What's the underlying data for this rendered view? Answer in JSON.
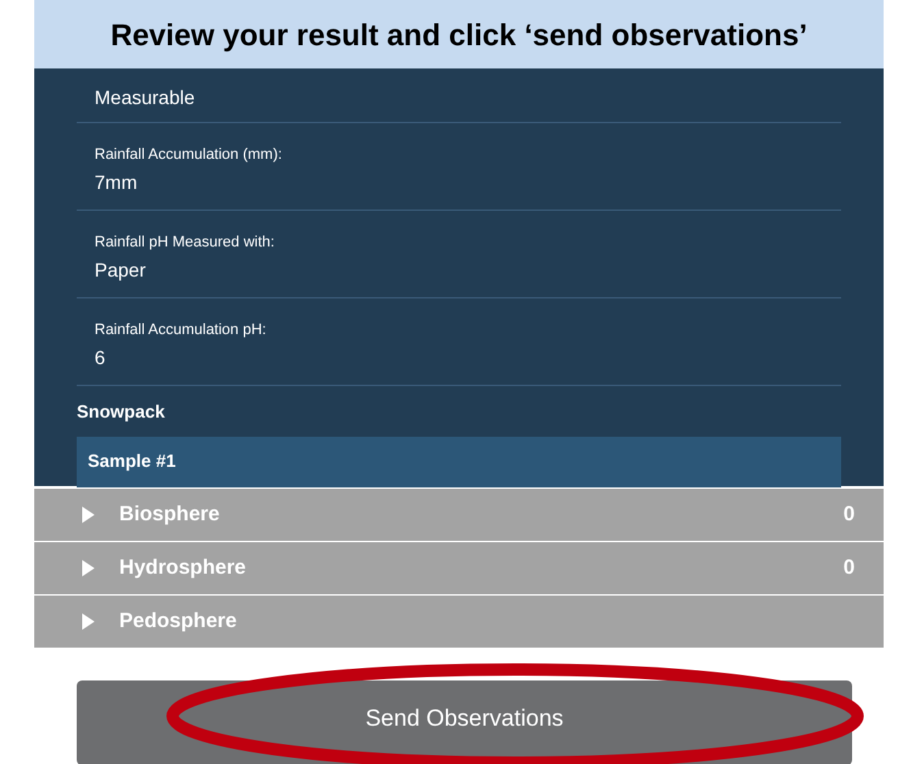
{
  "banner": {
    "title": "Review your result and click ‘send observations’"
  },
  "fields": [
    {
      "value": "Measurable"
    },
    {
      "label": "Rainfall Accumulation (mm):",
      "value": "7mm"
    },
    {
      "label": "Rainfall pH Measured with:",
      "value": "Paper"
    },
    {
      "label": "Rainfall Accumulation pH:",
      "value": "6"
    }
  ],
  "section": {
    "title": "Snowpack",
    "samples": [
      {
        "label": "Sample #1"
      }
    ]
  },
  "categories": [
    {
      "name": "Biosphere",
      "count": "0",
      "expanded": false
    },
    {
      "name": "Hydrosphere",
      "count": "0",
      "expanded": false
    },
    {
      "name": "Pedosphere",
      "expanded": false
    }
  ],
  "button": {
    "label": "Send Observations",
    "highlighted": true
  }
}
